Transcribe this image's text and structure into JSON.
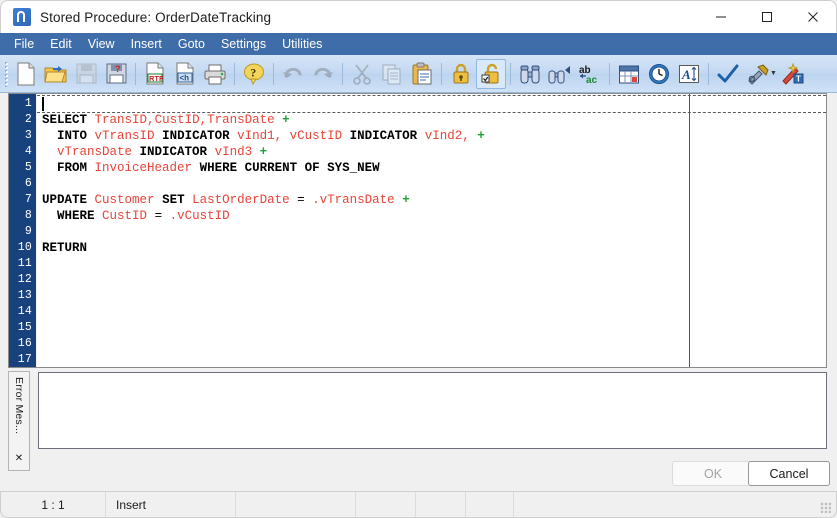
{
  "window": {
    "title": "Stored Procedure: OrderDateTracking",
    "app_icon": "app-icon",
    "controls": {
      "minimize": "minimize-icon",
      "maximize": "maximize-icon",
      "close": "close-icon"
    }
  },
  "menubar": {
    "items": [
      {
        "label": "File"
      },
      {
        "label": "Edit"
      },
      {
        "label": "View"
      },
      {
        "label": "Insert"
      },
      {
        "label": "Goto"
      },
      {
        "label": "Settings"
      },
      {
        "label": "Utilities"
      }
    ]
  },
  "toolbar": {
    "buttons": [
      {
        "name": "new-document-icon",
        "tooltip": "New",
        "enabled": true
      },
      {
        "name": "open-folder-icon",
        "tooltip": "Open",
        "enabled": true
      },
      {
        "name": "save-disk-icon",
        "tooltip": "Save",
        "enabled": false
      },
      {
        "name": "save-as-icon",
        "tooltip": "Save As",
        "enabled": true
      },
      {
        "name": "export-rtf-icon",
        "tooltip": "Export RTF",
        "enabled": true
      },
      {
        "name": "export-html-icon",
        "tooltip": "Export HTML",
        "enabled": true
      },
      {
        "name": "print-icon",
        "tooltip": "Print",
        "enabled": true
      },
      {
        "name": "help-question-icon",
        "tooltip": "Help",
        "enabled": true
      },
      {
        "name": "undo-icon",
        "tooltip": "Undo",
        "enabled": false
      },
      {
        "name": "redo-icon",
        "tooltip": "Redo",
        "enabled": false
      },
      {
        "name": "cut-scissors-icon",
        "tooltip": "Cut",
        "enabled": false
      },
      {
        "name": "copy-icon",
        "tooltip": "Copy",
        "enabled": false
      },
      {
        "name": "paste-clipboard-icon",
        "tooltip": "Paste",
        "enabled": true
      },
      {
        "name": "lock-closed-icon",
        "tooltip": "Lock",
        "enabled": true
      },
      {
        "name": "lock-open-icon",
        "tooltip": "Unlock",
        "enabled": true,
        "active": true
      },
      {
        "name": "find-binoculars-icon",
        "tooltip": "Find",
        "enabled": true
      },
      {
        "name": "find-next-icon",
        "tooltip": "Find Next",
        "enabled": true
      },
      {
        "name": "replace-abac-icon",
        "tooltip": "Replace",
        "enabled": true
      },
      {
        "name": "calendar-icon",
        "tooltip": "Date",
        "enabled": true
      },
      {
        "name": "clock-icon",
        "tooltip": "Time",
        "enabled": true
      },
      {
        "name": "font-icon",
        "tooltip": "Font",
        "enabled": true
      },
      {
        "name": "check-validate-icon",
        "tooltip": "Validate",
        "enabled": true
      },
      {
        "name": "tools-hammer-icon",
        "tooltip": "Tools",
        "enabled": true,
        "has_dropdown": true
      },
      {
        "name": "wizard-wand-icon",
        "tooltip": "Wizard",
        "enabled": true
      }
    ]
  },
  "editor": {
    "gutter_lines": [
      "1",
      "2",
      "3",
      "4",
      "5",
      "6",
      "7",
      "8",
      "9",
      "10",
      "11",
      "12",
      "13",
      "14",
      "15",
      "16",
      "17"
    ],
    "caret_line": 1,
    "code_lines": [
      {
        "n": 1,
        "tokens": []
      },
      {
        "n": 2,
        "tokens": [
          {
            "t": "SELECT",
            "c": "kw"
          },
          {
            "t": " ",
            "c": "op"
          },
          {
            "t": "TransID",
            "c": "id"
          },
          {
            "t": ",",
            "c": "id"
          },
          {
            "t": "CustID",
            "c": "id"
          },
          {
            "t": ",",
            "c": "id"
          },
          {
            "t": "TransDate",
            "c": "id"
          },
          {
            "t": " ",
            "c": "op"
          },
          {
            "t": "+",
            "c": "plus"
          }
        ]
      },
      {
        "n": 3,
        "tokens": [
          {
            "t": "  ",
            "c": "op"
          },
          {
            "t": "INTO",
            "c": "kw"
          },
          {
            "t": " ",
            "c": "op"
          },
          {
            "t": "vTransID",
            "c": "id"
          },
          {
            "t": " ",
            "c": "op"
          },
          {
            "t": "INDICATOR",
            "c": "kw"
          },
          {
            "t": " ",
            "c": "op"
          },
          {
            "t": "vInd1,",
            "c": "id"
          },
          {
            "t": " ",
            "c": "op"
          },
          {
            "t": "vCustID",
            "c": "id"
          },
          {
            "t": " ",
            "c": "op"
          },
          {
            "t": "INDICATOR",
            "c": "kw"
          },
          {
            "t": " ",
            "c": "op"
          },
          {
            "t": "vInd2,",
            "c": "id"
          },
          {
            "t": " ",
            "c": "op"
          },
          {
            "t": "+",
            "c": "plus"
          }
        ]
      },
      {
        "n": 4,
        "tokens": [
          {
            "t": "  ",
            "c": "op"
          },
          {
            "t": "vTransDate",
            "c": "id"
          },
          {
            "t": " ",
            "c": "op"
          },
          {
            "t": "INDICATOR",
            "c": "kw"
          },
          {
            "t": " ",
            "c": "op"
          },
          {
            "t": "vInd3",
            "c": "id"
          },
          {
            "t": " ",
            "c": "op"
          },
          {
            "t": "+",
            "c": "plus"
          }
        ]
      },
      {
        "n": 5,
        "tokens": [
          {
            "t": "  ",
            "c": "op"
          },
          {
            "t": "FROM",
            "c": "kw"
          },
          {
            "t": " ",
            "c": "op"
          },
          {
            "t": "InvoiceHeader",
            "c": "id"
          },
          {
            "t": " ",
            "c": "op"
          },
          {
            "t": "WHERE CURRENT OF SYS_NEW",
            "c": "kw"
          }
        ]
      },
      {
        "n": 6,
        "tokens": []
      },
      {
        "n": 7,
        "tokens": [
          {
            "t": "UPDATE",
            "c": "kw"
          },
          {
            "t": " ",
            "c": "op"
          },
          {
            "t": "Customer",
            "c": "id"
          },
          {
            "t": " ",
            "c": "op"
          },
          {
            "t": "SET",
            "c": "kw"
          },
          {
            "t": " ",
            "c": "op"
          },
          {
            "t": "LastOrderDate",
            "c": "id"
          },
          {
            "t": " ",
            "c": "op"
          },
          {
            "t": "=",
            "c": "op"
          },
          {
            "t": " ",
            "c": "op"
          },
          {
            "t": ".vTransDate",
            "c": "id"
          },
          {
            "t": " ",
            "c": "op"
          },
          {
            "t": "+",
            "c": "plus"
          }
        ]
      },
      {
        "n": 8,
        "tokens": [
          {
            "t": "  ",
            "c": "op"
          },
          {
            "t": "WHERE",
            "c": "kw"
          },
          {
            "t": " ",
            "c": "op"
          },
          {
            "t": "CustID",
            "c": "id"
          },
          {
            "t": " ",
            "c": "op"
          },
          {
            "t": "=",
            "c": "op"
          },
          {
            "t": " ",
            "c": "op"
          },
          {
            "t": ".vCustID",
            "c": "id"
          }
        ]
      },
      {
        "n": 9,
        "tokens": []
      },
      {
        "n": 10,
        "tokens": [
          {
            "t": "RETURN",
            "c": "kw"
          }
        ]
      },
      {
        "n": 11,
        "tokens": []
      },
      {
        "n": 12,
        "tokens": []
      },
      {
        "n": 13,
        "tokens": []
      },
      {
        "n": 14,
        "tokens": []
      },
      {
        "n": 15,
        "tokens": []
      },
      {
        "n": 16,
        "tokens": []
      },
      {
        "n": 17,
        "tokens": []
      }
    ]
  },
  "error_panel": {
    "tab_label": "Error Mes...",
    "close_label": "✕",
    "content": ""
  },
  "buttons": {
    "ok_label": "OK",
    "ok_enabled": false,
    "cancel_label": "Cancel",
    "cancel_enabled": true
  },
  "statusbar": {
    "position": "1 : 1",
    "mode": "Insert",
    "cell3": "",
    "cell4": "",
    "cell5": "",
    "cell6": "",
    "cell7": ""
  },
  "colors": {
    "menubar_blue": "#3f6da9",
    "gutter_navy": "#17427e",
    "identifier_red": "#e8443a",
    "operator_green": "#1fa03c",
    "toolbar_blue": "#c3d9f2"
  }
}
